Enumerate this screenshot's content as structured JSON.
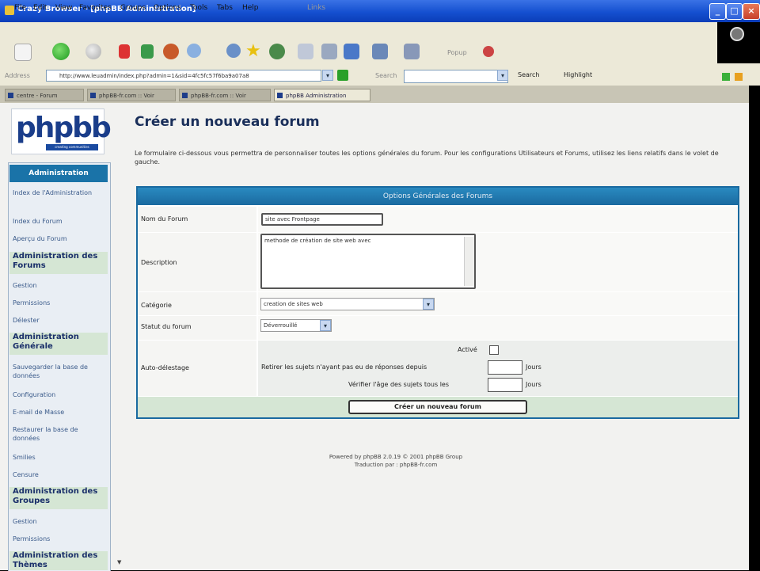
{
  "window": {
    "title": "Crazy Browser - [phpBB Administration]",
    "controls": [
      "_",
      "□",
      "×"
    ]
  },
  "menubar": {
    "items": [
      "File",
      "Edit",
      "View",
      "Favorites",
      "Groups",
      "Options",
      "Tools",
      "Tabs",
      "Help"
    ],
    "extra": "Links"
  },
  "toolbar": {
    "label": "Popup",
    "icons": [
      "new-page-icon",
      "back-icon",
      "forward-icon",
      "stop-icon",
      "refresh-icon",
      "home-icon",
      "search-icon",
      "favorites-icon",
      "history-icon",
      "print-icon",
      "edit-icon",
      "mail-icon",
      "windows-icon",
      "popup-icon"
    ]
  },
  "addressbar": {
    "label": "Address",
    "url": "http://www.leuadmin/index.php?admin=1&sid=4fc5fc57f6ba9a07a8",
    "search_label": "Search",
    "search_button": "Search",
    "highlight_button": "Highlight"
  },
  "tabs": [
    {
      "label": "centre - Forum"
    },
    {
      "label": "phpBB-fr.com :: Voir"
    },
    {
      "label": "phpBB-fr.com :: Voir"
    },
    {
      "label": "phpBB Administration"
    }
  ],
  "sidebar": {
    "logo": "phpbb",
    "logo_sub": "creating communities",
    "header": "Administration",
    "sections": [
      {
        "title": "",
        "links": [
          "Index de l'Administration",
          "Index du Forum",
          "Aperçu du Forum"
        ]
      },
      {
        "title": "Administration des Forums",
        "links": [
          "Gestion",
          "Permissions",
          "Délester"
        ]
      },
      {
        "title": "Administration Générale",
        "links": [
          "Sauvegarder la base de données",
          "Configuration",
          "E-mail de Masse",
          "Restaurer la base de données",
          "Smilies",
          "Censure"
        ]
      },
      {
        "title": "Administration des Groupes",
        "links": [
          "Gestion",
          "Permissions"
        ]
      },
      {
        "title": "Administration des Thèmes",
        "links": []
      }
    ]
  },
  "main": {
    "title": "Créer un nouveau forum",
    "description": "Le formulaire ci-dessous vous permettra de personnaliser toutes les options générales du forum. Pour les configurations Utilisateurs et Forums, utilisez les liens relatifs dans le volet de gauche.",
    "form": {
      "header": "Options Générales des Forums",
      "name_label": "Nom du Forum",
      "name_value": "site avec Frontpage",
      "description_label": "Description",
      "description_value": "methode de création de site web avec",
      "category_label": "Catégorie",
      "category_value": "creation de sites web",
      "status_label": "Statut du forum",
      "status_value": "Déverrouillé",
      "autoprune_label": "Auto-délestage",
      "active_label": "Activé",
      "prune_days_label": "Retirer les sujets n'ayant pas eu de réponses depuis",
      "prune_days_unit": "Jours",
      "prune_freq_label": "Vérifier l'âge des sujets tous les",
      "prune_freq_unit": "Jours",
      "submit": "Créer un nouveau forum"
    },
    "footer": {
      "powered": "Powered by phpBB 2.0.19 © 2001 phpBB Group",
      "translation": "Traduction par : phpBB-fr.com"
    }
  }
}
